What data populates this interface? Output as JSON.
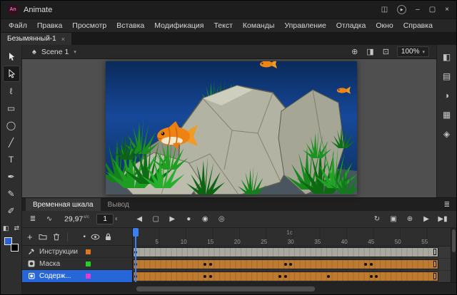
{
  "titlebar": {
    "logo_text": "An",
    "app": "Animate",
    "workspace_icon": "◫",
    "circle_glyph": "▶",
    "minimize": "–",
    "maximize": "▢",
    "close": "×"
  },
  "menubar": {
    "items": [
      "Файл",
      "Правка",
      "Просмотр",
      "Вставка",
      "Модификация",
      "Текст",
      "Команды",
      "Управление",
      "Отладка",
      "Окно",
      "Справка"
    ]
  },
  "document_tab": {
    "title": "Безымянный-1",
    "close": "×"
  },
  "edit_bar": {
    "scene_icon": "♠",
    "scene": "Scene 1",
    "chevron": "▾",
    "zoom": "100%",
    "actions": [
      {
        "name": "center-stage-button",
        "icon": "⊕"
      },
      {
        "name": "rotation-button",
        "icon": "◨"
      },
      {
        "name": "clip-content-button",
        "icon": "⊡"
      }
    ]
  },
  "tools": [
    {
      "name": "selection-tool",
      "icon": "@arrow-filled",
      "active": false
    },
    {
      "name": "subselection-tool",
      "icon": "@arrow-outline",
      "active": true
    },
    {
      "name": "lasso-tool",
      "icon": "ℓ",
      "active": false
    },
    {
      "name": "rectangle-tool",
      "icon": "▭",
      "active": false
    },
    {
      "name": "oval-tool",
      "icon": "◯",
      "active": false
    },
    {
      "name": "line-tool",
      "icon": "╱",
      "active": false
    },
    {
      "name": "text-tool",
      "icon": "T",
      "active": false
    },
    {
      "name": "pen-tool",
      "icon": "✒",
      "active": false
    },
    {
      "name": "pencil-tool",
      "icon": "✎",
      "active": false
    },
    {
      "name": "brush-tool",
      "icon": "✐",
      "active": false
    }
  ],
  "color_chips": {
    "default_icon": "◧",
    "swap_icon": "⇄",
    "fill_color": "#2B62D9",
    "stroke_color": "#000000"
  },
  "right_strip": [
    {
      "name": "properties-panel-icon",
      "icon": "◧"
    },
    {
      "name": "library-panel-icon",
      "icon": "▤"
    },
    {
      "name": "color-panel-icon",
      "icon": "◑"
    },
    {
      "name": "align-panel-icon",
      "icon": "▦"
    },
    {
      "name": "snippets-panel-icon",
      "icon": "◈"
    }
  ],
  "timeline": {
    "tabs": [
      {
        "label": "Временная шкала",
        "active": true
      },
      {
        "label": "Вывод",
        "active": false
      }
    ],
    "panel_menu_icon": "≣",
    "fps": "29,97",
    "fps_unit": "к/с",
    "frame": "1",
    "frame_unit": "к",
    "controls_left": [
      {
        "name": "layer-view-toggle",
        "icon": "≣"
      },
      {
        "name": "graph-editor-toggle",
        "icon": "∿"
      }
    ],
    "controls_center": [
      {
        "name": "step-back-button",
        "icon": "◀"
      },
      {
        "name": "stop-button",
        "icon": "▢"
      },
      {
        "name": "step-forward-button",
        "icon": "▶"
      },
      {
        "name": "auto-keyframe-toggle",
        "icon": "●"
      },
      {
        "name": "onion-skin-button",
        "icon": "◉"
      },
      {
        "name": "onion-outline-button",
        "icon": "◎"
      }
    ],
    "controls_right": [
      {
        "name": "loop-button",
        "icon": "↻"
      },
      {
        "name": "edit-multiple-frames-button",
        "icon": "▣"
      },
      {
        "name": "center-frame-button",
        "icon": "⊕"
      },
      {
        "name": "play-button",
        "icon": "▶"
      },
      {
        "name": "step-end-button",
        "icon": "▶▮"
      }
    ],
    "layer_toolbar": [
      {
        "name": "new-layer-button",
        "icon": "+"
      },
      {
        "name": "new-folder-button",
        "icon": "@folder"
      },
      {
        "name": "delete-layer-button",
        "icon": "@trash"
      }
    ],
    "column_headers": [
      {
        "name": "highlight-column-header",
        "icon": "•"
      },
      {
        "name": "visibility-column-header",
        "icon": "@eye"
      },
      {
        "name": "lock-column-header",
        "icon": "@lock"
      }
    ],
    "ruler": {
      "numbers": [
        5,
        10,
        15,
        20,
        25,
        30,
        35,
        40,
        45,
        50,
        55
      ],
      "second_marker": "1с",
      "frame_width": 7.5
    },
    "layers": [
      {
        "name": "Инструкции",
        "type": "guide",
        "color": "#E2761B",
        "selected": false,
        "span_end": 57,
        "span_color": "#A9A9A0",
        "keyframes": [
          1
        ]
      },
      {
        "name": "Маска",
        "type": "mask",
        "color": "#25D025",
        "selected": false,
        "span_end": 57,
        "span_color": "#BE7A2E",
        "keyframes": [
          1,
          14,
          15,
          29,
          30,
          44,
          45
        ]
      },
      {
        "name": "Содерж...",
        "type": "masked",
        "color": "#E23BD0",
        "selected": true,
        "span_end": 57,
        "span_color": "#BE7A2E",
        "keyframes": [
          1,
          14,
          15,
          28,
          29,
          37,
          45,
          46
        ]
      }
    ]
  },
  "stage": {
    "colors": {
      "water_top": "#0A2A5C",
      "water_mid": "#16489A",
      "sand": "#49555F",
      "rock": "#B3B3A3",
      "plant": "#1D9E22",
      "fish": "#EE8314"
    }
  }
}
